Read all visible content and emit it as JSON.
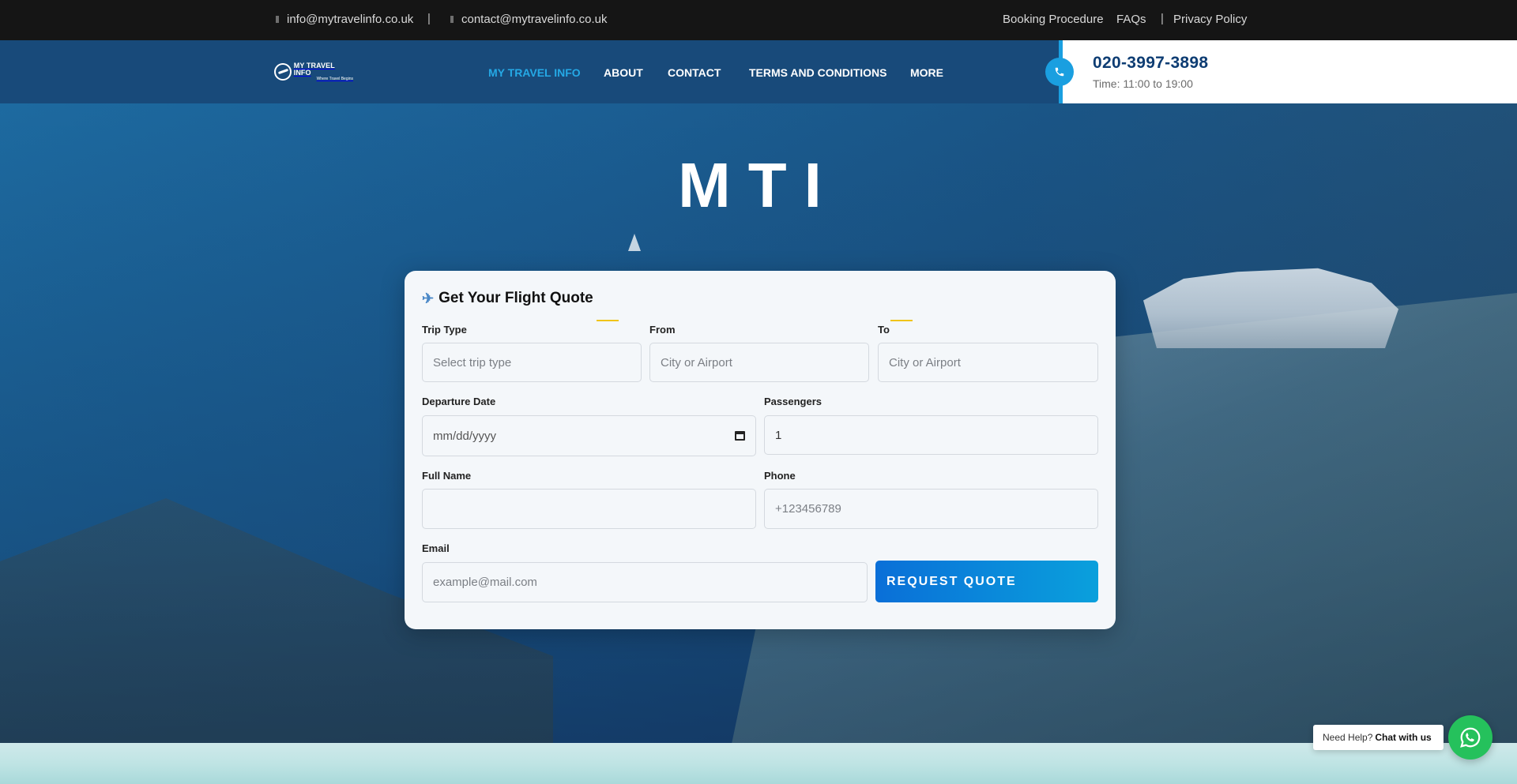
{
  "topbar": {
    "email1": "info@mytravelinfo.co.uk",
    "email2": "contact@mytravelinfo.co.uk",
    "links": [
      "Booking Procedure",
      "FAQs",
      "Privacy Policy"
    ],
    "separator": "|"
  },
  "header": {
    "logo_line1": "MY TRAVEL INFO",
    "logo_line2": "Where Travel Begins",
    "nav": [
      "MY TRAVEL INFO",
      "ABOUT",
      "CONTACT",
      "TERMS AND CONDITIONS",
      "MORE"
    ],
    "active_nav": "MY TRAVEL INFO",
    "phone": "020-3997-3898",
    "hours": "Time: 11:00 to 19:00"
  },
  "hero": {
    "title": "MTI"
  },
  "form": {
    "title": "Get Your Flight Quote",
    "icon": "airplane-icon",
    "trip_type": {
      "label": "Trip Type",
      "placeholder": "Select trip type"
    },
    "from": {
      "label": "From",
      "placeholder": "City or Airport"
    },
    "to": {
      "label": "To",
      "placeholder": "City or Airport"
    },
    "departure": {
      "label": "Departure Date",
      "placeholder": "mm/dd/yyyy"
    },
    "passengers": {
      "label": "Passengers",
      "value": "1"
    },
    "full_name": {
      "label": "Full Name",
      "placeholder": ""
    },
    "phone": {
      "label": "Phone",
      "placeholder": "+123456789"
    },
    "email": {
      "label": "Email",
      "placeholder": "example@mail.com"
    },
    "submit": "REQUEST QUOTE"
  },
  "chat": {
    "prefix": "Need Help?",
    "action": "Chat with us"
  },
  "colors": {
    "accent": "#1a9fe0",
    "header_bg": "#184a7a",
    "topbar_bg": "#151515",
    "whatsapp": "#25c15c",
    "nav_active": "#25a9e6"
  }
}
